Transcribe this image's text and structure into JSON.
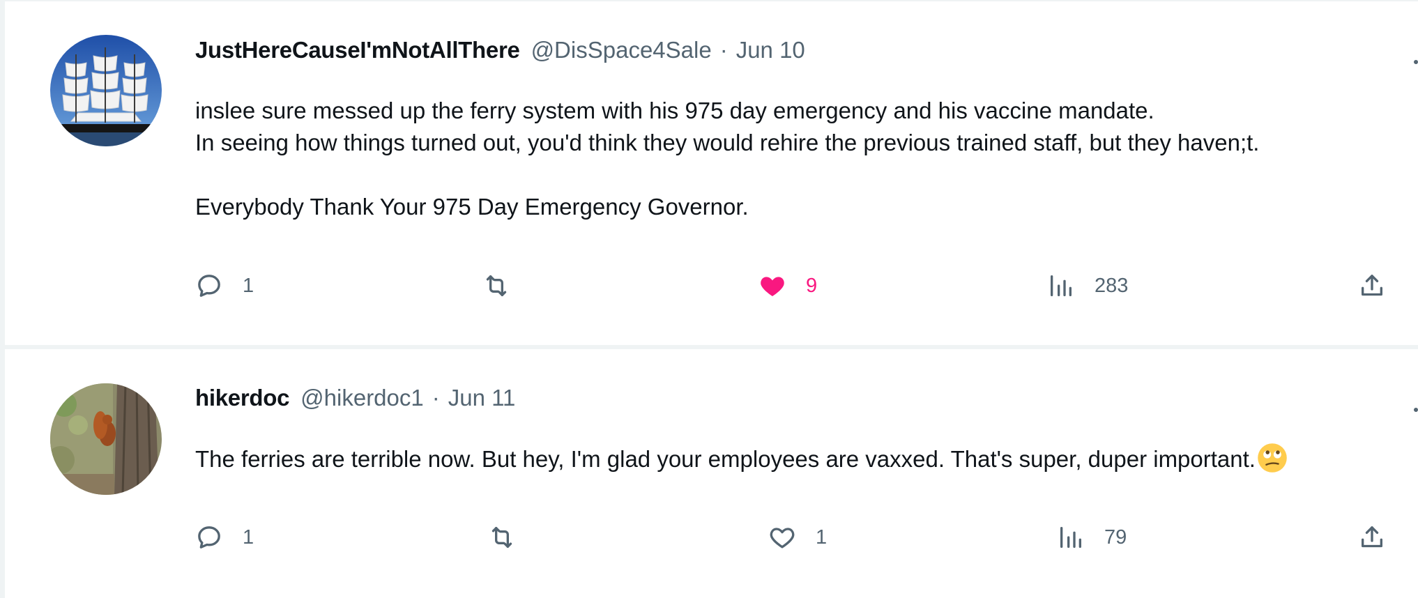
{
  "colors": {
    "text": "#0f1419",
    "secondary": "#536471",
    "like_active": "#f91880",
    "divider": "#eff3f4",
    "emoji": "#ffcc4d"
  },
  "tweets": [
    {
      "display_name": "JustHereCauseI'mNotAllThere",
      "handle": "@DisSpace4Sale",
      "separator": "·",
      "date": "Jun 10",
      "avatar_icon": "sailing-ship-avatar",
      "text_lines": [
        "inslee sure messed up the ferry system with his 975 day emergency and his vaccine mandate.",
        "In seeing how things turned out, you'd think they would rehire the previous trained staff, but they haven;t.",
        "",
        "Everybody Thank Your 975 Day Emergency Governor."
      ],
      "replies": "1",
      "reposts": "",
      "likes": "9",
      "liked": true,
      "views": "283"
    },
    {
      "display_name": "hikerdoc",
      "handle": "@hikerdoc1",
      "separator": "·",
      "date": "Jun 11",
      "avatar_icon": "squirrel-on-tree-avatar",
      "text": "The ferries are terrible now. But hey, I'm glad your employees are vaxxed. That's super, duper important.",
      "emoji": "face-with-rolling-eyes-icon",
      "replies": "1",
      "reposts": "",
      "likes": "1",
      "liked": false,
      "views": "79"
    }
  ]
}
